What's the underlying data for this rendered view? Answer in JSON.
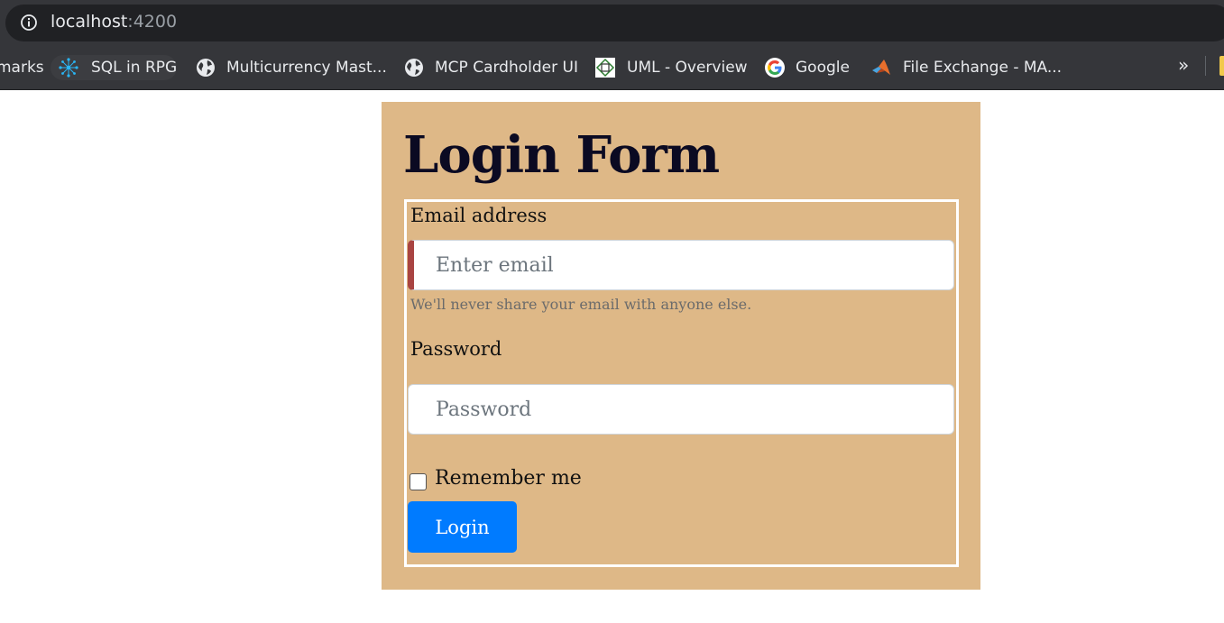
{
  "browser": {
    "url_host": "localhost",
    "url_port": ":4200",
    "bookmarks": [
      {
        "label": "marks",
        "icon": "none"
      },
      {
        "label": "SQL in RPG",
        "icon": "network-icon"
      },
      {
        "label": "Multicurrency Mast...",
        "icon": "globe-icon"
      },
      {
        "label": "MCP Cardholder UI",
        "icon": "globe-icon"
      },
      {
        "label": "UML - Overview",
        "icon": "uml-icon"
      },
      {
        "label": "Google",
        "icon": "google-icon"
      },
      {
        "label": "File Exchange - MA...",
        "icon": "matlab-icon"
      }
    ],
    "more": "»"
  },
  "page": {
    "title": "Login Form",
    "email": {
      "label": "Email address",
      "placeholder": "Enter email",
      "help": "We'll never share your email with anyone else."
    },
    "password": {
      "label": "Password",
      "placeholder": "Password"
    },
    "remember": {
      "label": "Remember me",
      "checked": false
    },
    "submit_label": "Login"
  },
  "colors": {
    "panel_bg": "#deb887",
    "button_bg": "#007bff",
    "invalid_border": "#a94442"
  }
}
